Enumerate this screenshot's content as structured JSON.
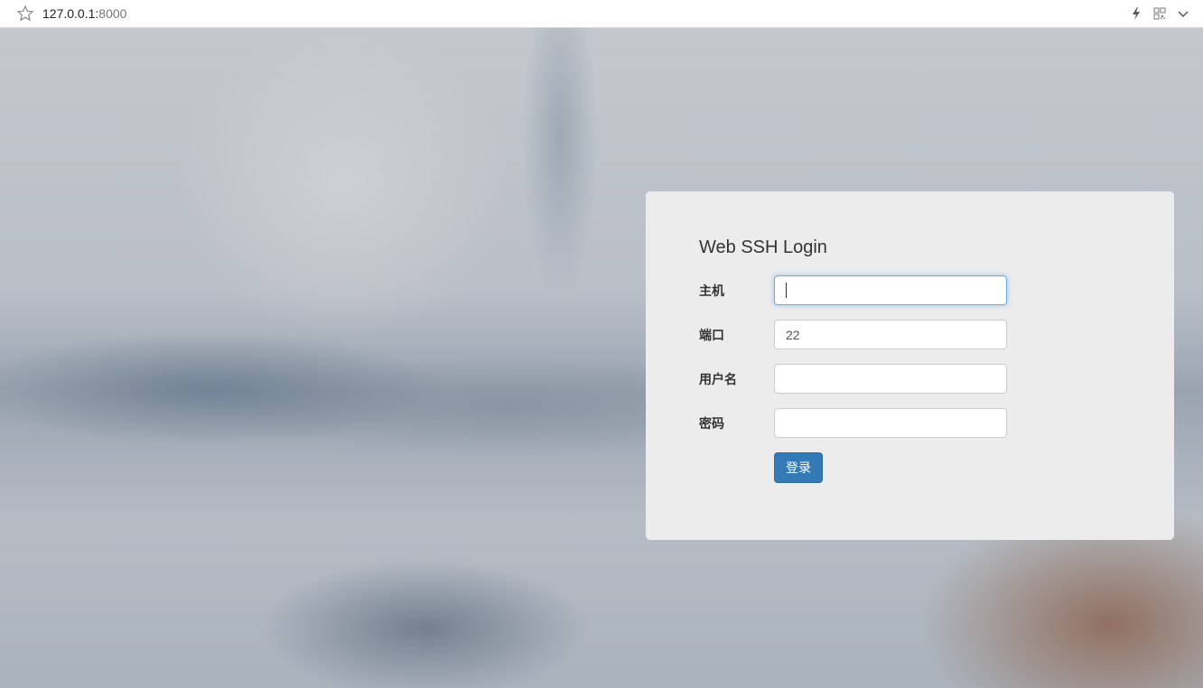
{
  "browser": {
    "url_host": "127.0.0.1:",
    "url_port": "8000",
    "icons": [
      "star-icon",
      "lightning-icon",
      "qr-code-icon",
      "chevron-down-icon"
    ]
  },
  "login": {
    "title": "Web SSH Login",
    "fields": [
      {
        "label": "主机",
        "value": "",
        "type": "text"
      },
      {
        "label": "端口",
        "value": "22",
        "type": "text"
      },
      {
        "label": "用户名",
        "value": "",
        "type": "text"
      },
      {
        "label": "密码",
        "value": "",
        "type": "password"
      }
    ],
    "submit_label": "登录"
  },
  "colors": {
    "panel_bg": "#ececec",
    "button_bg": "#337ab7",
    "focus_border": "#66afe9"
  }
}
